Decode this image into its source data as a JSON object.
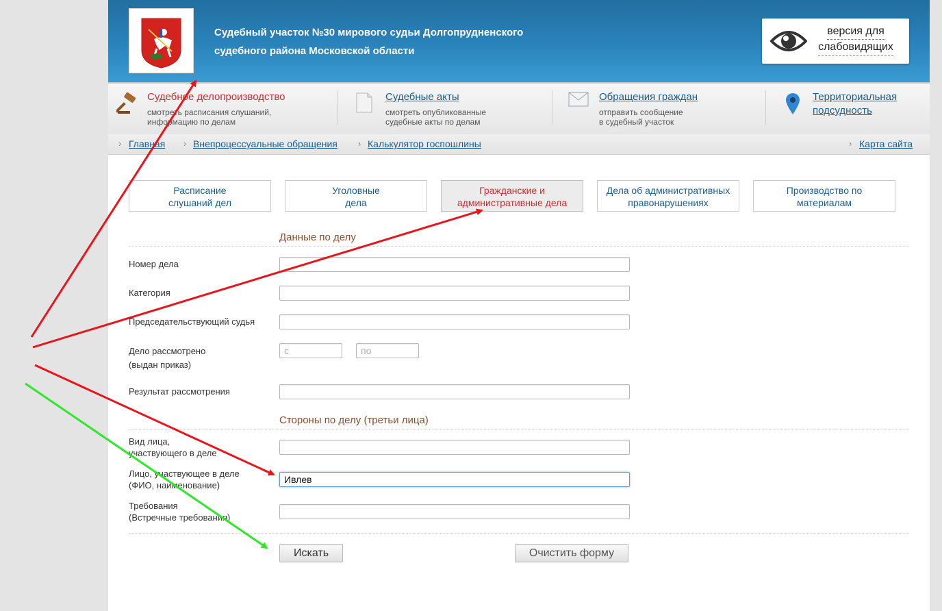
{
  "header": {
    "court_name_line1": "Судебный участок №30 мирового судьи Долгопрудненского",
    "court_name_line2": "судебного района Московской области",
    "low_vision_line1": "версия для",
    "low_vision_line2": "слабовидящих"
  },
  "topmenu": {
    "items": [
      {
        "title": "Судебное делопроизводство",
        "desc1": "смотреть расписания слушаний,",
        "desc2": "информацию по делам"
      },
      {
        "title": "Судебные акты",
        "desc1": "смотреть опубликованные",
        "desc2": "судебные акты по делам"
      },
      {
        "title": "Обращения граждан",
        "desc1": "отправить сообщение",
        "desc2": "в судебный участок"
      },
      {
        "title1": "Территориальная",
        "title2": "подсудность"
      }
    ]
  },
  "breadcrumbs": {
    "home": "Главная",
    "extra": "Внепроцессуальные обращения",
    "calc": "Калькулятор госпошлины",
    "sitemap": "Карта сайта"
  },
  "tabs": [
    {
      "line1": "Расписание",
      "line2": "слушаний дел"
    },
    {
      "line1": "Уголовные",
      "line2": "дела"
    },
    {
      "line1": "Гражданские и",
      "line2": "административные дела"
    },
    {
      "line1": "Дела об административных",
      "line2": "правонарушениях"
    },
    {
      "line1": "Производство по",
      "line2": "материалам"
    }
  ],
  "form": {
    "section1_title": "Данные по делу",
    "case_number_label": "Номер дела",
    "category_label": "Категория",
    "judge_label": "Председательствующий судья",
    "considered_label1": "Дело рассмотрено",
    "considered_label2": "(выдан приказ)",
    "date_from_placeholder": "с",
    "date_to_placeholder": "по",
    "result_label": "Результат рассмотрения",
    "section2_title": "Стороны по делу (третьи лица)",
    "party_type_label1": "Вид лица,",
    "party_type_label2": "участвующего в деле",
    "party_label1": "Лицо, участвующее в деле",
    "party_label2": "(ФИО, наименование)",
    "party_value": "Ивлев",
    "claims_label1": "Требования",
    "claims_label2": "(Встречные требования)",
    "search_button": "Искать",
    "clear_button": "Очистить форму"
  },
  "colors": {
    "header_blue": "#2a84bb",
    "active_red": "#c53131",
    "link_blue": "#1a5d8f",
    "annotation_red": "#e8161c",
    "annotation_green": "#2ee82a"
  }
}
